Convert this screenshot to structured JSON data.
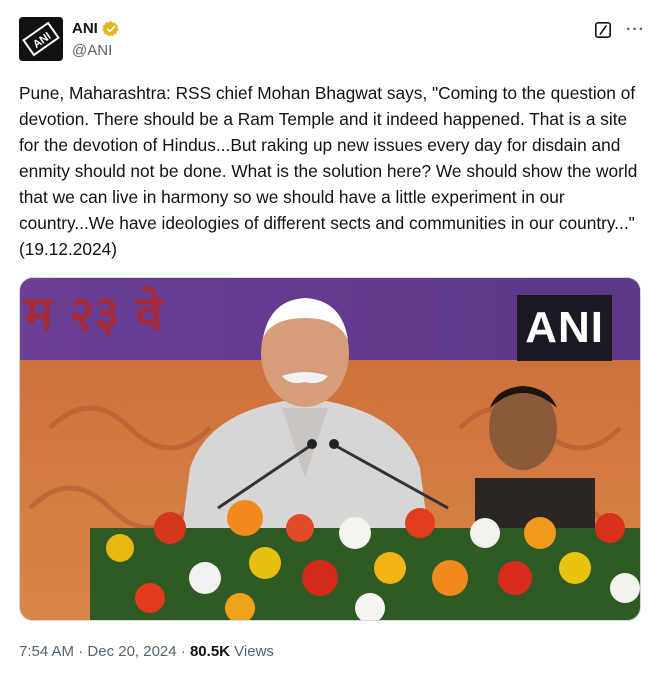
{
  "author": {
    "display_name": "ANI",
    "handle": "@ANI",
    "avatar_text": "ANI",
    "verified_icon": "verified-gold-badge-icon"
  },
  "actions": {
    "grok_icon": "grok-icon",
    "more_icon": "more-options-icon",
    "more_glyph": "···"
  },
  "tweet": {
    "text": "Pune, Maharashtra: RSS chief Mohan Bhagwat says, \"Coming to the question of devotion. There should be a Ram Temple and it indeed happened. That is a site for the devotion of Hindus...But raking up new issues every day for disdain and enmity should not be done. What is the solution here? We should show the world that we can live in harmony so we should have a little experiment in our country...We have ideologies of different sects and communities in our country...\" (19.12.2024)"
  },
  "media": {
    "watermark": "ANI",
    "banner_text": "म २३ वे"
  },
  "meta": {
    "time": "7:54 AM",
    "separator": " · ",
    "date": "Dec 20, 2024",
    "views_count": "80.5K",
    "views_label": " Views"
  },
  "colors": {
    "verified": "#e2b719",
    "secondary_text": "#536471",
    "primary_text": "#0f1419"
  }
}
